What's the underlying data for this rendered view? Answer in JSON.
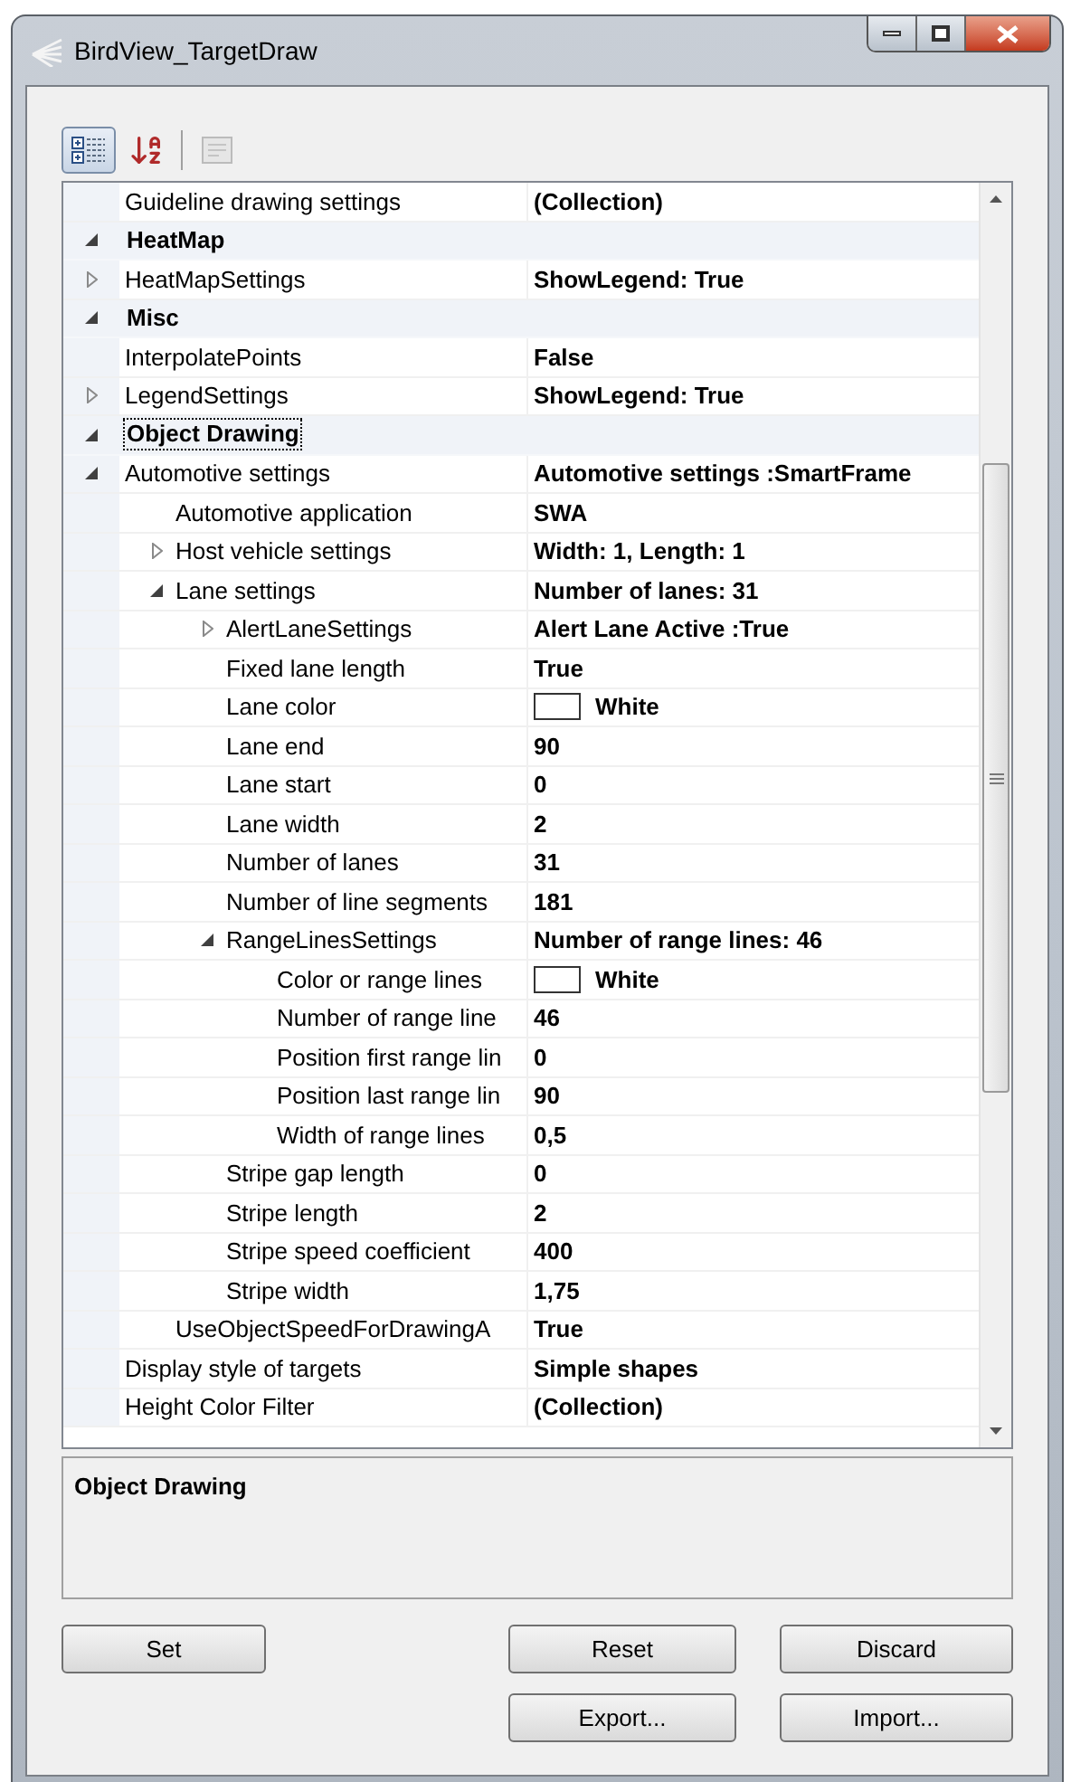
{
  "window": {
    "title": "BirdView_TargetDraw"
  },
  "toolbar": [
    {
      "kind": "categorized",
      "selected": true
    },
    {
      "kind": "alphabetical",
      "selected": false
    },
    {
      "kind": "pages",
      "disabled": true
    }
  ],
  "grid": {
    "rows": [
      {
        "name": "Guideline drawing settings",
        "value": "(Collection)",
        "selected": false
      },
      {
        "kind": "category",
        "name": "HeatMap",
        "expanded": true,
        "selected": false,
        "children": [
          {
            "name": "HeatMapSettings",
            "value": "ShowLegend: True",
            "expanded": false,
            "selected": false
          }
        ]
      },
      {
        "kind": "category",
        "name": "Misc",
        "expanded": true,
        "selected": false,
        "children": [
          {
            "name": "InterpolatePoints",
            "value": "False",
            "selected": false
          },
          {
            "name": "LegendSettings",
            "value": "ShowLegend: True",
            "expanded": false,
            "selected": false
          }
        ]
      },
      {
        "kind": "category",
        "name": "Object Drawing",
        "expanded": true,
        "selected": true,
        "children": [
          {
            "name": "Automotive settings",
            "value": "Automotive settings :SmartFrame",
            "expanded": true,
            "selected": false,
            "children": [
              {
                "name": "Automotive application",
                "value": "SWA",
                "selected": false
              },
              {
                "name": "Host vehicle settings",
                "value": "Width: 1, Length: 1",
                "expanded": false,
                "selected": false
              },
              {
                "name": "Lane settings",
                "value": "Number of lanes: 31",
                "expanded": true,
                "selected": false,
                "children": [
                  {
                    "name": "AlertLaneSettings",
                    "value": "Alert Lane Active :True",
                    "expanded": false,
                    "selected": false
                  },
                  {
                    "name": "Fixed lane length",
                    "value": "True",
                    "selected": false
                  },
                  {
                    "name": "Lane color",
                    "value": "White",
                    "color": "#ffffff",
                    "selected": false
                  },
                  {
                    "name": "Lane end",
                    "value": "90",
                    "selected": false
                  },
                  {
                    "name": "Lane start",
                    "value": "0",
                    "selected": false
                  },
                  {
                    "name": "Lane width",
                    "value": "2",
                    "selected": false
                  },
                  {
                    "name": "Number of lanes",
                    "value": "31",
                    "selected": false
                  },
                  {
                    "name": "Number of line segments",
                    "value": "181",
                    "selected": false
                  },
                  {
                    "name": "RangeLinesSettings",
                    "value": "Number of range lines: 46",
                    "expanded": true,
                    "selected": false,
                    "children": [
                      {
                        "name": "Color or range lines",
                        "value": "White",
                        "color": "#ffffff",
                        "selected": false
                      },
                      {
                        "name": "Number of range line",
                        "value": "46",
                        "selected": false
                      },
                      {
                        "name": "Position first range lin",
                        "value": "0",
                        "selected": false
                      },
                      {
                        "name": "Position last range lin",
                        "value": "90",
                        "selected": false
                      },
                      {
                        "name": "Width of range lines",
                        "value": "0,5",
                        "selected": false
                      }
                    ]
                  },
                  {
                    "name": "Stripe gap length",
                    "value": "0",
                    "selected": false
                  },
                  {
                    "name": "Stripe length",
                    "value": "2",
                    "selected": false
                  },
                  {
                    "name": "Stripe speed coefficient",
                    "value": "400",
                    "selected": false
                  },
                  {
                    "name": "Stripe width",
                    "value": "1,75",
                    "selected": false
                  }
                ]
              },
              {
                "name": "UseObjectSpeedForDrawingA",
                "value": "True",
                "selected": false
              }
            ]
          },
          {
            "name": "Display style of targets",
            "value": "Simple shapes",
            "selected": false
          },
          {
            "name": "Height Color Filter",
            "value": "(Collection)",
            "selected": false
          }
        ]
      }
    ]
  },
  "description": {
    "title": "Object Drawing"
  },
  "buttons": [
    [
      "Set",
      "Reset",
      "Discard"
    ],
    [
      "Export...",
      "Import..."
    ]
  ]
}
